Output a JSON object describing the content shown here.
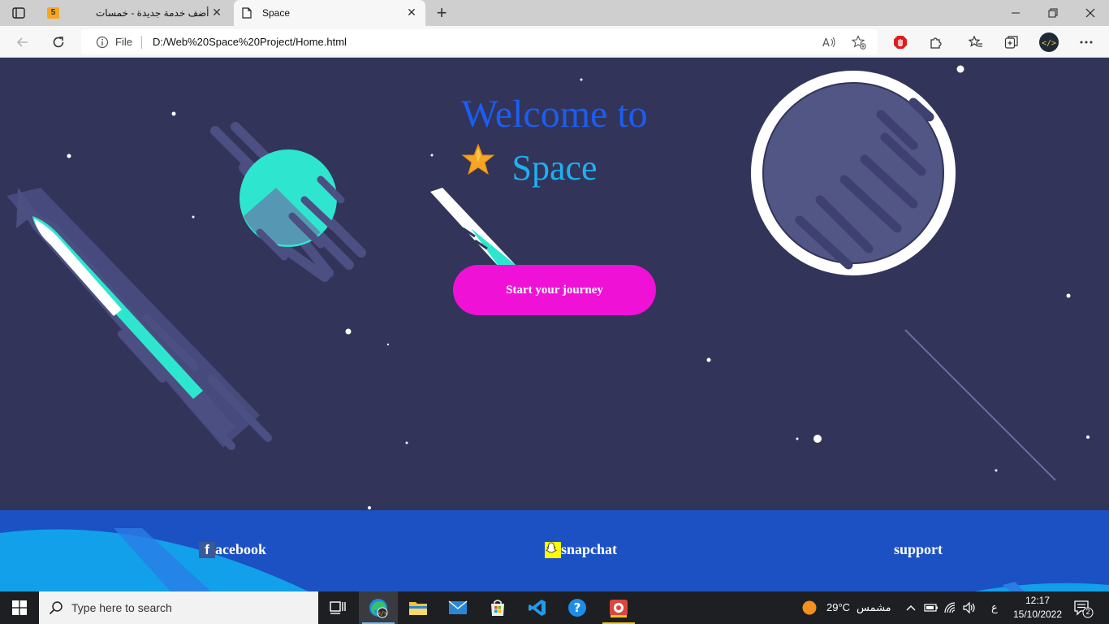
{
  "browser": {
    "tabs": [
      {
        "title": "أضف خدمة جديدة - خمسات",
        "favicon": "khamsat-favicon",
        "badge": "5"
      },
      {
        "title": "Space",
        "favicon": "page-icon"
      }
    ],
    "address": {
      "protocol_label": "File",
      "url": "D:/Web%20Space%20Project/Home.html"
    }
  },
  "page": {
    "title_line1": "Welcome to",
    "title_line2": "Space",
    "cta": "Start your journey",
    "colors": {
      "background": "#32345a",
      "title": "#1a5ef2",
      "subtitle": "#1fb0f2",
      "cta": "#f011d6",
      "footer": "#1b51c2"
    },
    "footer": {
      "facebook": "acebook",
      "facebook_icon_letter": "f",
      "snapchat": "snapchat",
      "support": "support"
    }
  },
  "taskbar": {
    "search_placeholder": "Type here to search",
    "weather": "29°C",
    "weather_desc": "مشمس",
    "lang": "ع",
    "time": "12:17",
    "date": "15/10/2022",
    "notifications": "2"
  }
}
